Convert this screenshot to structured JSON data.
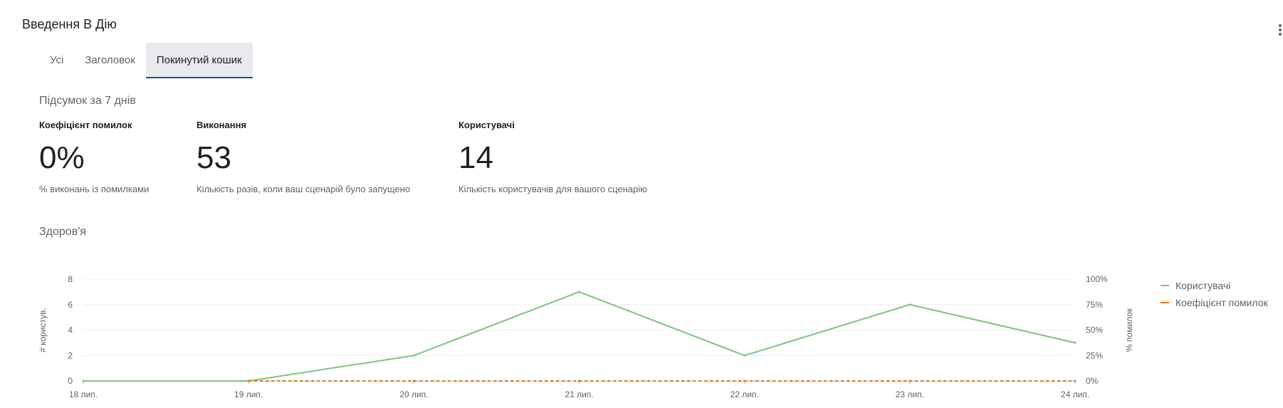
{
  "header": {
    "title": "Введення В Дію"
  },
  "tabs": [
    {
      "label": "Усі",
      "active": false
    },
    {
      "label": "Заголовок",
      "active": false
    },
    {
      "label": "Покинутий кошик",
      "active": true
    }
  ],
  "summary": {
    "title": "Підсумок за 7 днів",
    "metrics": [
      {
        "label": "Коефіцієнт помилок",
        "value": "0%",
        "description": "% виконань із помилками"
      },
      {
        "label": "Виконання",
        "value": "53",
        "description": "Кількість разів, коли ваш сценарій було запущено"
      },
      {
        "label": "Користувачі",
        "value": "14",
        "description": "Кількість користувачів для вашого сценарію"
      }
    ]
  },
  "health": {
    "title": "Здоров'я"
  },
  "chart_data": {
    "type": "line",
    "x": [
      "18 лип.",
      "19 лип.",
      "20 лип.",
      "21 лип.",
      "22 лип.",
      "23 лип.",
      "24 лип."
    ],
    "ylabel": "# користув.",
    "ylabel_right": "% помилок",
    "ylim": [
      0,
      8
    ],
    "yticks": [
      "0",
      "2",
      "4",
      "6",
      "8"
    ],
    "ylim_right": [
      0,
      100
    ],
    "yticks_right": [
      "0%",
      "25%",
      "50%",
      "75%",
      "100%"
    ],
    "grid": true,
    "legend_position": "right",
    "series": [
      {
        "name": "Користувачі",
        "axis": "left",
        "color": "#7bc67e",
        "style": "solid",
        "values": [
          0,
          0,
          2,
          7,
          2,
          6,
          3
        ]
      },
      {
        "name": "Коефіцієнт помилок",
        "axis": "right",
        "color": "#e8710a",
        "style": "dashed",
        "values": [
          null,
          0,
          0,
          0,
          0,
          0,
          0
        ]
      }
    ]
  }
}
